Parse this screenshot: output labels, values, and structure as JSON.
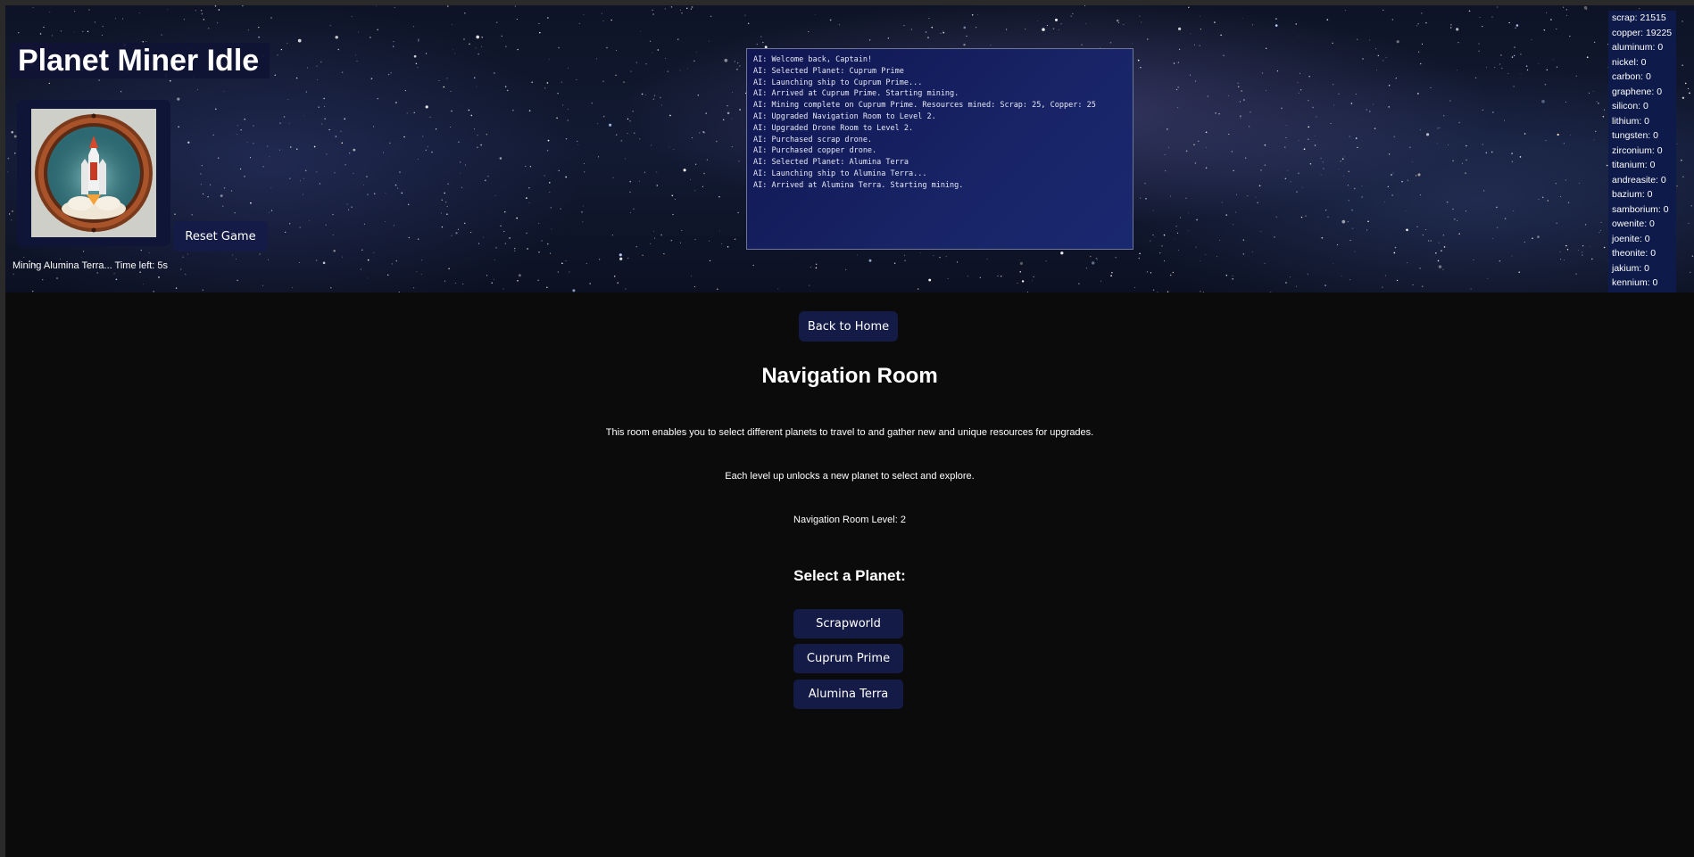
{
  "app": {
    "title": "Planet Miner Idle",
    "reset_label": "Reset Game",
    "mining_status": "Mining Alumina Terra... Time left: 5s"
  },
  "log": [
    "AI: Welcome back, Captain!",
    "AI: Selected Planet: Cuprum Prime",
    "AI: Launching ship to Cuprum Prime...",
    "AI: Arrived at Cuprum Prime. Starting mining.",
    "AI: Mining complete on Cuprum Prime. Resources mined: Scrap: 25, Copper: 25",
    "AI: Upgraded Navigation Room to Level 2.",
    "AI: Upgraded Drone Room to Level 2.",
    "AI: Purchased scrap drone.",
    "AI: Purchased copper drone.",
    "AI: Selected Planet: Alumina Terra",
    "AI: Launching ship to Alumina Terra...",
    "AI: Arrived at Alumina Terra. Starting mining."
  ],
  "resources": [
    "scrap: 21515",
    "copper: 19225",
    "aluminum: 0",
    "nickel: 0",
    "carbon: 0",
    "graphene: 0",
    "silicon: 0",
    "lithium: 0",
    "tungsten: 0",
    "zirconium: 0",
    "titanium: 0",
    "andreasite: 0",
    "bazium: 0",
    "samborium: 0",
    "owenite: 0",
    "joenite: 0",
    "theonite: 0",
    "jakium: 0",
    "kennium: 0"
  ],
  "room": {
    "back_label": "Back to Home",
    "title": "Navigation Room",
    "description": "This room enables you to select different planets to travel to and gather new and unique resources for upgrades.",
    "unlock_text": "Each level up unlocks a new planet to select and explore.",
    "level_text": "Navigation Room Level: 2",
    "select_title": "Select a Planet:",
    "planets": [
      "Scrapworld",
      "Cuprum Prime",
      "Alumina Terra"
    ]
  },
  "colors": {
    "panel": "#141b46",
    "log_bg": "#182466",
    "page_bg": "#0b0b0b"
  },
  "icons": {
    "ship": "rocket-porthole-icon"
  }
}
